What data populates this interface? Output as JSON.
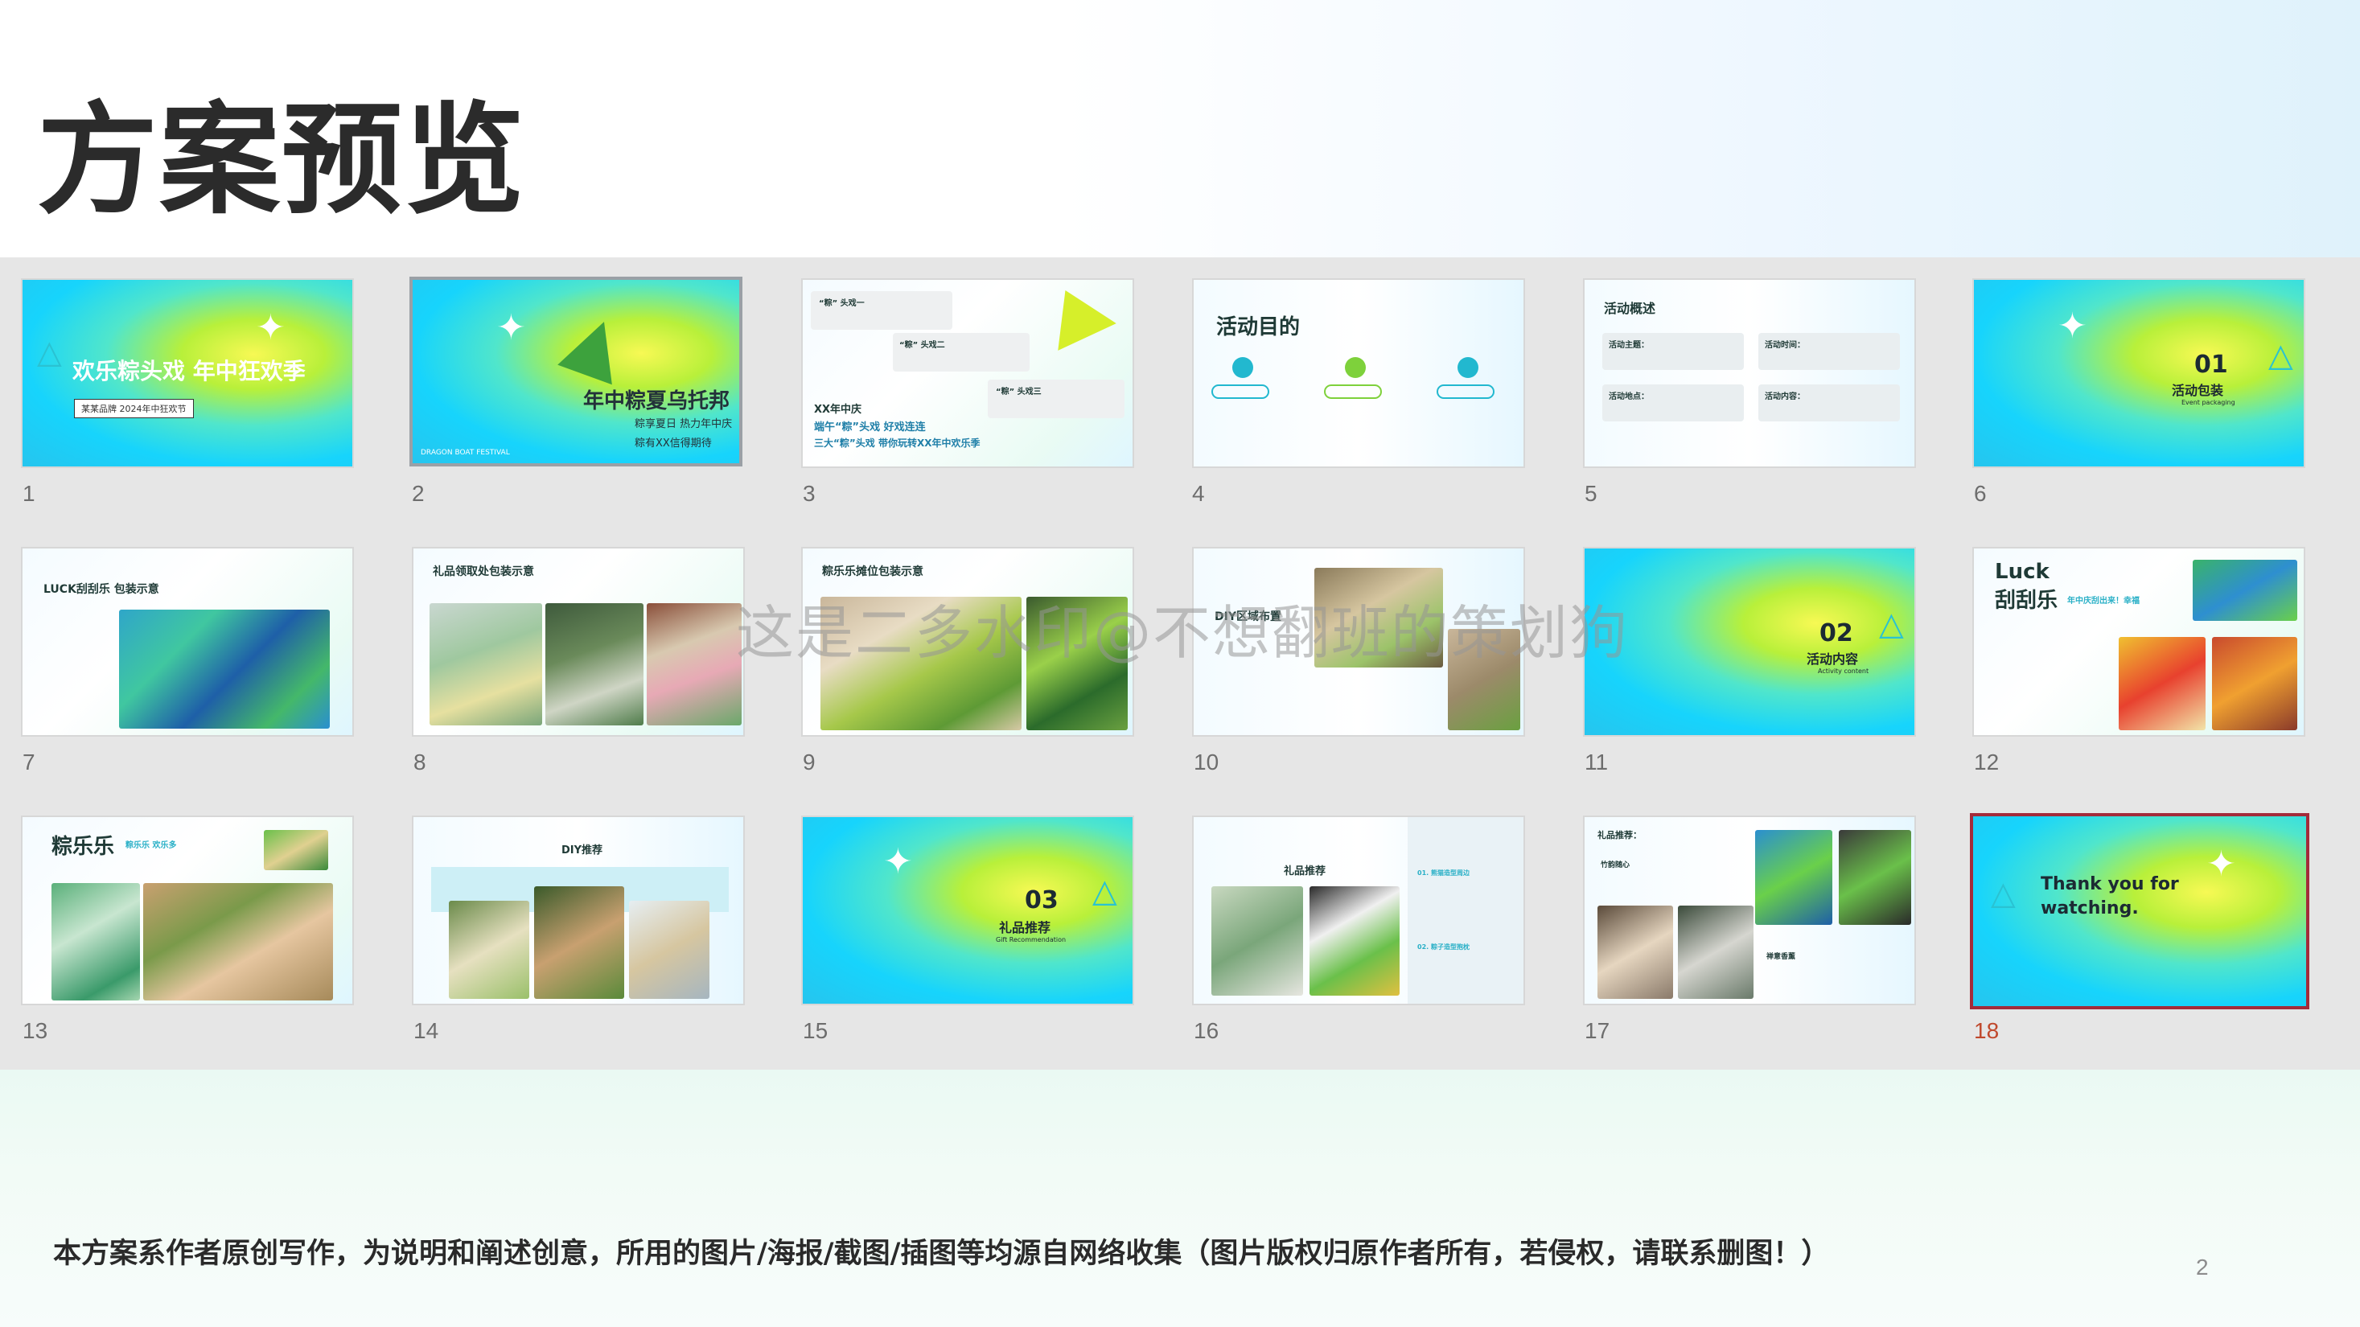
{
  "page": {
    "title": "方案预览",
    "watermark": "这是二多水印@不想翻班的策划狗",
    "disclaimer": "本方案系作者原创写作，为说明和阐述创意，所用的图片/海报/截图/插图等均源自网络收集（图片版权归原作者所有，若侵权，请联系删图！）",
    "page_number": "2"
  },
  "colors": {
    "accent": "#c0492d",
    "selected_border": "#a32b3a",
    "grid_bg": "#e6e6e6"
  },
  "slides": [
    {
      "number": "1",
      "title": "欢乐粽头戏 年中狂欢季",
      "sub": "某某品牌 2024年中狂欢节",
      "icon": "triangle-icon"
    },
    {
      "number": "2",
      "title": "年中粽夏乌托邦",
      "line1": "粽享夏日 热力年中庆",
      "line2": "粽有XX信得期待",
      "corner": "DRAGON BOAT FESTIVAL"
    },
    {
      "number": "3",
      "line1": "XX年中庆",
      "line2": "端午“粽”头戏 好戏连连",
      "line3": "三大“粽”头戏 带你玩转XX年中欢乐季",
      "tag1": "“粽” 头戏一",
      "tag2": "“粽” 头戏二",
      "tag3": "“粽” 头戏三"
    },
    {
      "number": "4",
      "title": "活动目的"
    },
    {
      "number": "5",
      "title": "活动概述",
      "labels": [
        "活动主题：",
        "活动时间：",
        "活动地点：",
        "活动内容："
      ]
    },
    {
      "number": "6",
      "big": "01",
      "title": "活动包装",
      "sub": "Event packaging"
    },
    {
      "number": "7",
      "title": "LUCK刮刮乐 包装示意"
    },
    {
      "number": "8",
      "title": "礼品领取处包装示意"
    },
    {
      "number": "9",
      "title": "粽乐乐摊位包装示意"
    },
    {
      "number": "10",
      "title": "DIY区域布置"
    },
    {
      "number": "11",
      "big": "02",
      "title": "活动内容",
      "sub": "Activity content"
    },
    {
      "number": "12",
      "title": "Luck",
      "title2": "刮刮乐",
      "tag": "年中庆刮出来！幸福"
    },
    {
      "number": "13",
      "title": "粽乐乐",
      "tag": "粽乐乐 欢乐多"
    },
    {
      "number": "14",
      "title": "DIY推荐"
    },
    {
      "number": "15",
      "big": "03",
      "title": "礼品推荐",
      "sub": "Gift Recommendation"
    },
    {
      "number": "16",
      "title": "礼品推荐",
      "item1": "01. 熊猫造型周边",
      "item2": "02. 粽子造型抱枕"
    },
    {
      "number": "17",
      "title": "礼品推荐：",
      "label1": "竹韵随心",
      "label2": "禅意香薰"
    },
    {
      "number": "18",
      "line1": "Thank you for",
      "line2": "watching."
    }
  ]
}
